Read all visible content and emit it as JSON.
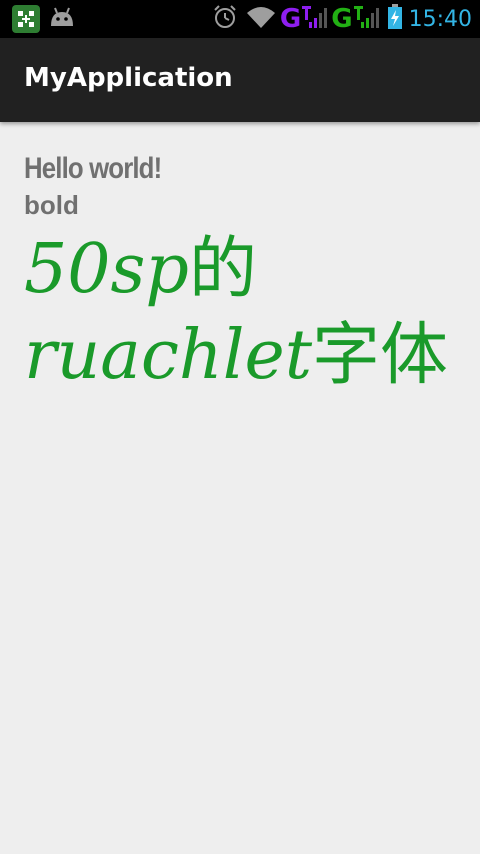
{
  "status_bar": {
    "left_icons": [
      "app-notification-icon",
      "android-icon"
    ],
    "right_icons": [
      "alarm-icon",
      "wifi-icon",
      "signal-icon",
      "signal-icon",
      "battery-icon"
    ],
    "network_1": "G",
    "network_2": "G",
    "time": "15:40",
    "colors": {
      "network_1": "#8e1ef0",
      "network_2": "#22b014",
      "clock": "#33b5e5"
    }
  },
  "action_bar": {
    "title": "MyApplication"
  },
  "content": {
    "hello": "Hello world!",
    "bold": "bold",
    "line1_styled": "50sp",
    "line1_cjk": "的",
    "line2_styled": "ruachlet",
    "line2_cjk": "字体",
    "colors": {
      "text_gray": "#707070",
      "accent_green": "#1a9a2a"
    }
  }
}
